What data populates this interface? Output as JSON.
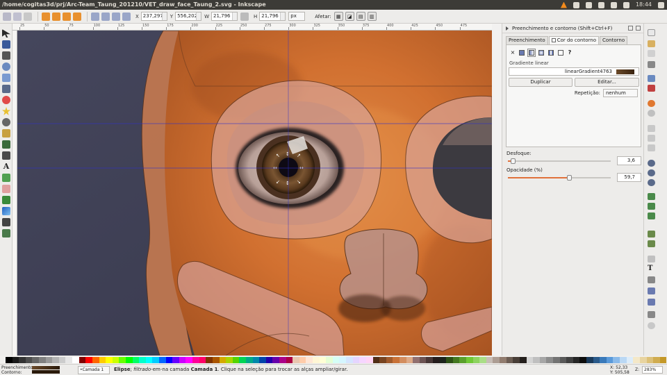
{
  "window": {
    "title": "/home/cogitas3d/prj/Arc-Team_Taung_201210/VET_draw_face_Taung_2.svg - Inkscape",
    "clock": "18:44"
  },
  "controls": {
    "x_label": "X",
    "x_value": "237,297",
    "y_label": "Y",
    "y_value": "556,202",
    "w_label": "W",
    "w_value": "21,796",
    "h_label": "H",
    "h_value": "21,796",
    "unit": "px",
    "affect_label": "Afetar:"
  },
  "ruler": {
    "ticks": [
      "25",
      "50",
      "75",
      "100",
      "125",
      "150",
      "175",
      "200",
      "225",
      "250",
      "275",
      "300",
      "325",
      "350",
      "375",
      "400",
      "425",
      "450",
      "475"
    ]
  },
  "dock": {
    "title": "Preenchimento e contorno (Shift+Ctrl+F)",
    "tabs": [
      "Preenchimento",
      "Cor do contorno",
      "Contorno"
    ],
    "active_tab": 1,
    "paint_types": [
      "none-icon",
      "flat-icon",
      "linear-gradient-icon",
      "radial-gradient-icon",
      "pattern-icon",
      "swatch-icon",
      "unset-icon"
    ],
    "unset_glyph": "?",
    "none_glyph": "×",
    "gradient_label": "Gradiente linear",
    "gradient_name": "linearGradient4763",
    "duplicate_label": "Duplicar",
    "edit_label": "Editar...",
    "repeat_label": "Repetição:",
    "repeat_value": "nenhum",
    "blur_label": "Desfoque:",
    "blur_value": "3,6",
    "blur_fraction": 0.05,
    "opacity_label": "Opacidade (%)",
    "opacity_value": "59,7",
    "opacity_fraction": 0.597
  },
  "status": {
    "fill_label": "Preenchimento:",
    "stroke_label": "Contorno:",
    "layer": "•Camada 1",
    "message_bold": "Elipse",
    "message_sep": ";",
    "message_italic": "filtrado",
    "message_mid": "-em-na camada",
    "message_layer": "Camada 1",
    "message_tail": ". Clique na seleção para trocar as alças ampliar/girar.",
    "x_label": "X:",
    "x_value": "52,33",
    "y_label": "Y:",
    "y_value": "505,58",
    "zoom_label": "Z:",
    "zoom_value": "283%"
  },
  "colors": {
    "skin": "#d9783a",
    "background_dark": "#3e3f55",
    "accent": "#e0703a",
    "guide": "#3030c8"
  },
  "palette": [
    "#000000",
    "#1a1a1a",
    "#333333",
    "#4d4d4d",
    "#666666",
    "#808080",
    "#999999",
    "#b3b3b3",
    "#cccccc",
    "#e6e6e6",
    "#ffffff",
    "#800000",
    "#ff0000",
    "#ff6600",
    "#ffcc00",
    "#ffff00",
    "#ccff00",
    "#66ff00",
    "#00ff00",
    "#00ff66",
    "#00ffcc",
    "#00ffff",
    "#00ccff",
    "#0066ff",
    "#0000ff",
    "#6600ff",
    "#cc00ff",
    "#ff00ff",
    "#ff0099",
    "#ff0066",
    "#803300",
    "#aa5500",
    "#d4aa00",
    "#aad400",
    "#55d400",
    "#00d455",
    "#00aa88",
    "#0088aa",
    "#0044aa",
    "#2200aa",
    "#6600aa",
    "#aa0088",
    "#aa0044",
    "#e9c6af",
    "#ffccaa",
    "#ffe6d5",
    "#fff6d5",
    "#ffffd5",
    "#e5ffd5",
    "#d5fff6",
    "#d5f6ff",
    "#d5e5ff",
    "#e5d5ff",
    "#f6d5ff",
    "#ffd5f6",
    "#502d16",
    "#784421",
    "#a05a2c",
    "#c87137",
    "#d38d5f",
    "#deaa87",
    "#916f6f",
    "#6c5353",
    "#483737",
    "#241c1c",
    "#1c241c",
    "#2d5016",
    "#447821",
    "#5aa02c",
    "#71c837",
    "#8dd35f",
    "#aade87",
    "#c8beb7",
    "#ac9d93",
    "#917c6f",
    "#6c5d53",
    "#483e37",
    "#241f1c",
    "#d4d4d4",
    "#bfbfbf",
    "#a6a6a6",
    "#8c8c8c",
    "#737373",
    "#595959",
    "#404040",
    "#262626",
    "#0d0d0d",
    "#1a3a5a",
    "#2a5a8a",
    "#3a7aba",
    "#5a9ada",
    "#8abaea",
    "#bad8f4",
    "#dcecfa",
    "#f4e8c8",
    "#e8d4a0",
    "#dcc078",
    "#d0ac50",
    "#c49828"
  ]
}
